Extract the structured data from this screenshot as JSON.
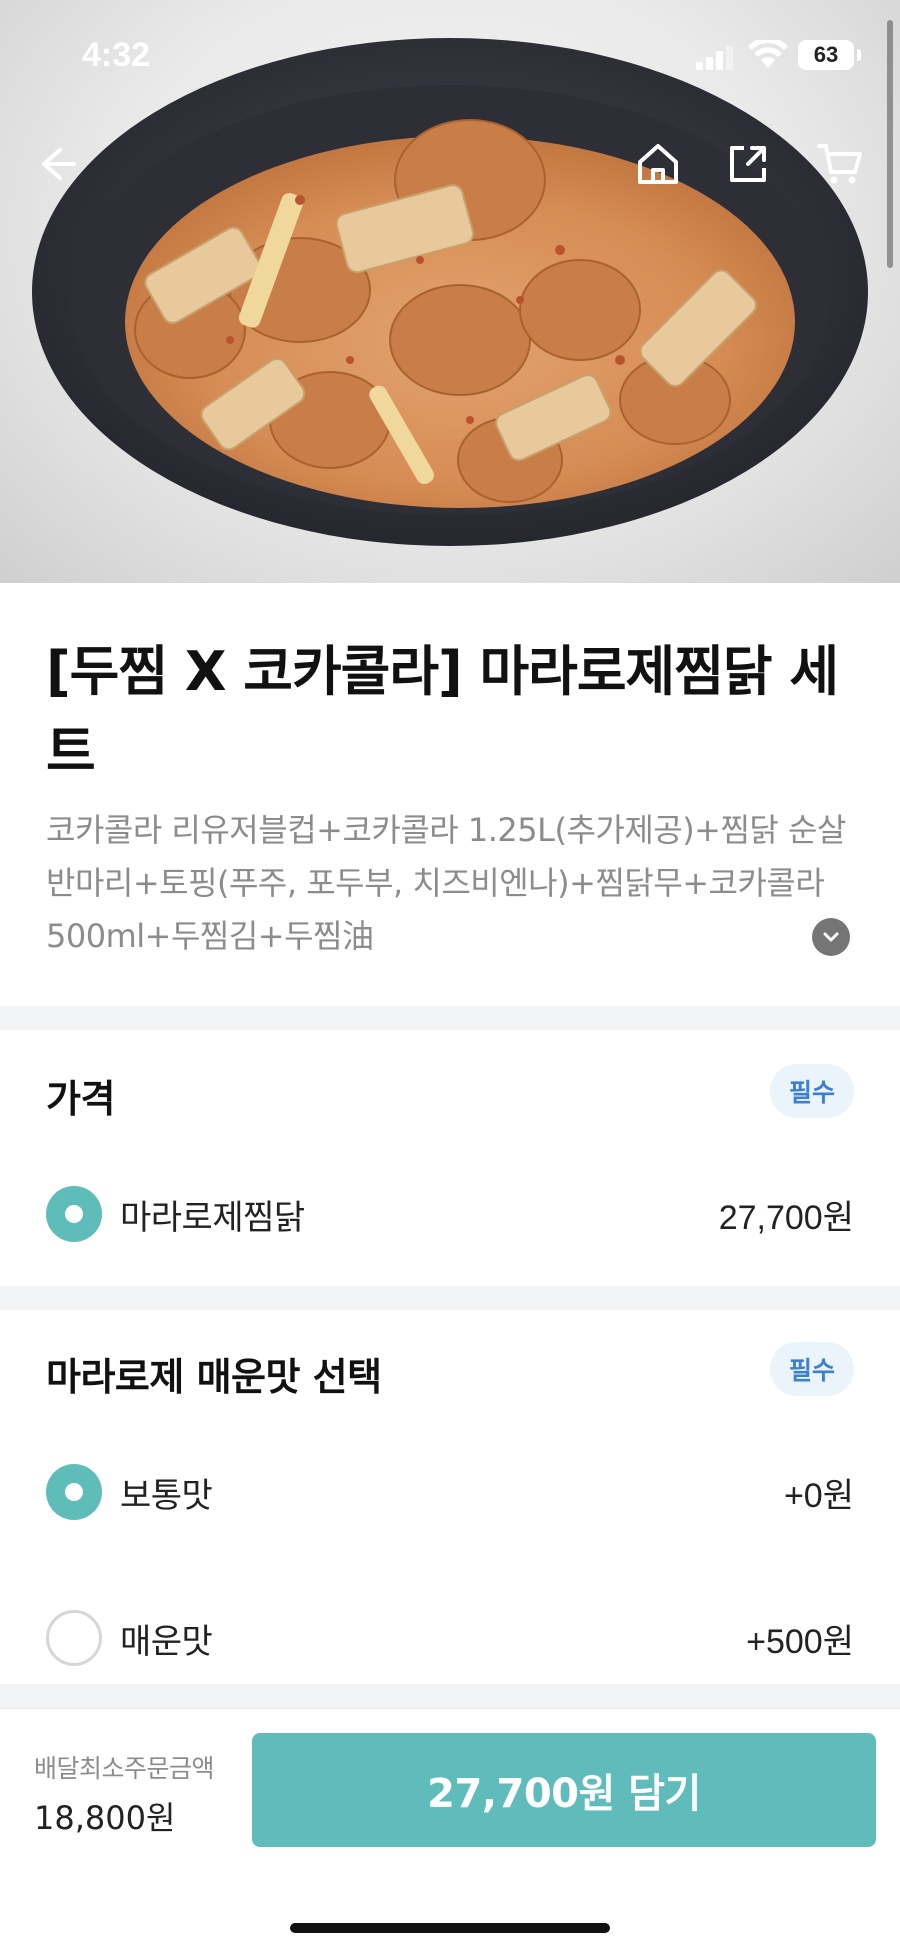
{
  "status_bar": {
    "time": "4:32",
    "battery": "63"
  },
  "product": {
    "title": "[두찜 X 코카콜라] 마라로제찜닭 세트",
    "description": "코카콜라 리유저블컵+코카콜라 1.25L(추가제공)+찜닭 순살반마리+토핑(푸주, 포두부, 치즈비엔나)+찜닭무+코카콜라500ml+두찜김+두찜油"
  },
  "sections": [
    {
      "title": "가격",
      "badge": "필수",
      "options": [
        {
          "label": "마라로제찜닭",
          "price": "27,700원",
          "selected": true
        }
      ]
    },
    {
      "title": "마라로제 매운맛 선택",
      "badge": "필수",
      "options": [
        {
          "label": "보통맛",
          "price": "+0원",
          "selected": true
        },
        {
          "label": "매운맛",
          "price": "+500원",
          "selected": false
        }
      ]
    }
  ],
  "bottom_bar": {
    "min_order_label": "배달최소주문금액",
    "min_order_value": "18,800원",
    "cta_label": "27,700원 담기"
  },
  "icons": {
    "back": "arrow-left-icon",
    "home": "home-icon",
    "share": "share-icon",
    "cart": "cart-icon",
    "expand": "chevron-down-icon"
  },
  "colors": {
    "accent": "#5fbcba",
    "badge_bg": "#ebf4fb",
    "badge_text": "#3d7fd4",
    "divider": "#f2f3f5"
  }
}
